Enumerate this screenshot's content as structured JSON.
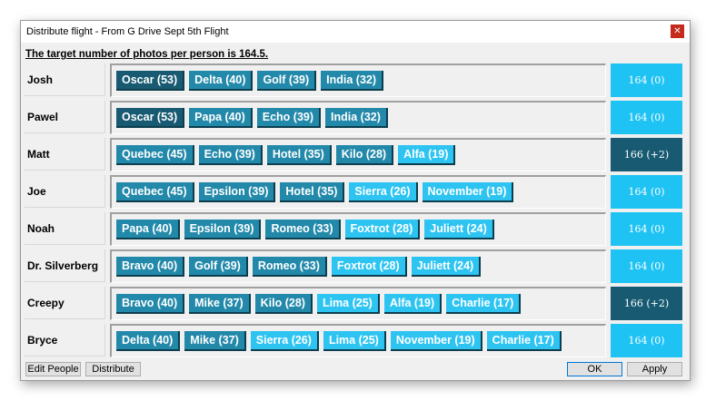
{
  "window": {
    "title": "Distribute flight - From G Drive Sept 5th Flight",
    "close_glyph": "✕"
  },
  "target_text": "The target number of photos per person is 164.5.",
  "colors": {
    "chip_dark": "#175a72",
    "chip_mid": "#2389aa",
    "chip_light": "#2ec4f2",
    "total_ok": "#1ec3f3",
    "total_over": "#175a72"
  },
  "rows": [
    {
      "name": "Josh",
      "total": "164 (0)",
      "status": "ok",
      "flights": [
        {
          "label": "Oscar (53)",
          "shade": "dark"
        },
        {
          "label": "Delta (40)",
          "shade": "mid"
        },
        {
          "label": "Golf (39)",
          "shade": "mid"
        },
        {
          "label": "India (32)",
          "shade": "mid"
        }
      ]
    },
    {
      "name": "Pawel",
      "total": "164 (0)",
      "status": "ok",
      "flights": [
        {
          "label": "Oscar (53)",
          "shade": "dark"
        },
        {
          "label": "Papa (40)",
          "shade": "mid"
        },
        {
          "label": "Echo (39)",
          "shade": "mid"
        },
        {
          "label": "India (32)",
          "shade": "mid"
        }
      ]
    },
    {
      "name": "Matt",
      "total": "166 (+2)",
      "status": "over",
      "flights": [
        {
          "label": "Quebec (45)",
          "shade": "mid"
        },
        {
          "label": "Echo (39)",
          "shade": "mid"
        },
        {
          "label": "Hotel (35)",
          "shade": "mid"
        },
        {
          "label": "Kilo (28)",
          "shade": "mid"
        },
        {
          "label": "Alfa (19)",
          "shade": "light"
        }
      ]
    },
    {
      "name": "Joe",
      "total": "164 (0)",
      "status": "ok",
      "flights": [
        {
          "label": "Quebec (45)",
          "shade": "mid"
        },
        {
          "label": "Epsilon (39)",
          "shade": "mid"
        },
        {
          "label": "Hotel (35)",
          "shade": "mid"
        },
        {
          "label": "Sierra (26)",
          "shade": "light"
        },
        {
          "label": "November (19)",
          "shade": "light"
        }
      ]
    },
    {
      "name": "Noah",
      "total": "164 (0)",
      "status": "ok",
      "flights": [
        {
          "label": "Papa (40)",
          "shade": "mid"
        },
        {
          "label": "Epsilon (39)",
          "shade": "mid"
        },
        {
          "label": "Romeo (33)",
          "shade": "mid"
        },
        {
          "label": "Foxtrot (28)",
          "shade": "light"
        },
        {
          "label": "Juliett (24)",
          "shade": "light"
        }
      ]
    },
    {
      "name": "Dr. Silverberg",
      "total": "164 (0)",
      "status": "ok",
      "flights": [
        {
          "label": "Bravo (40)",
          "shade": "mid"
        },
        {
          "label": "Golf (39)",
          "shade": "mid"
        },
        {
          "label": "Romeo (33)",
          "shade": "mid"
        },
        {
          "label": "Foxtrot (28)",
          "shade": "light"
        },
        {
          "label": "Juliett (24)",
          "shade": "light"
        }
      ]
    },
    {
      "name": "Creepy",
      "total": "166 (+2)",
      "status": "over",
      "flights": [
        {
          "label": "Bravo (40)",
          "shade": "mid"
        },
        {
          "label": "Mike (37)",
          "shade": "mid"
        },
        {
          "label": "Kilo (28)",
          "shade": "mid"
        },
        {
          "label": "Lima (25)",
          "shade": "light"
        },
        {
          "label": "Alfa (19)",
          "shade": "light"
        },
        {
          "label": "Charlie (17)",
          "shade": "light"
        }
      ]
    },
    {
      "name": "Bryce",
      "total": "164 (0)",
      "status": "ok",
      "flights": [
        {
          "label": "Delta (40)",
          "shade": "mid"
        },
        {
          "label": "Mike (37)",
          "shade": "mid"
        },
        {
          "label": "Sierra (26)",
          "shade": "light"
        },
        {
          "label": "Lima (25)",
          "shade": "light"
        },
        {
          "label": "November (19)",
          "shade": "light"
        },
        {
          "label": "Charlie (17)",
          "shade": "light"
        }
      ]
    }
  ],
  "buttons": {
    "edit_people": "Edit People",
    "distribute": "Distribute",
    "ok": "OK",
    "apply": "Apply"
  }
}
